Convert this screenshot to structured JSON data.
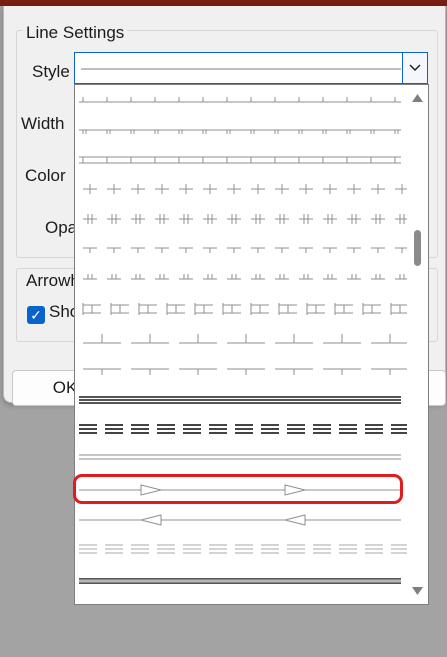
{
  "dialog": {
    "group_line_settings": "Line Settings",
    "label_style": "Style",
    "label_width": "Width",
    "label_color": "Color",
    "label_opacity_partial": "Opa",
    "group_arrowheads_partial": "Arrowh",
    "checkbox_show_partial": "Sho",
    "checkbox_checked": true,
    "ok_label": "OK"
  },
  "dropdown": {
    "scroll_position": 0.28,
    "highlighted_option_index": 14,
    "options": [
      {
        "style": "ticks-single-up"
      },
      {
        "style": "ticks-double-down"
      },
      {
        "style": "ticks-bars-down"
      },
      {
        "style": "crosses"
      },
      {
        "style": "double-crosses"
      },
      {
        "style": "ticks-down-single"
      },
      {
        "style": "ticks-double-up"
      },
      {
        "style": "dash-ibeams"
      },
      {
        "style": "dash-up-bars"
      },
      {
        "style": "dash-down-ticks"
      },
      {
        "style": "triple-thick"
      },
      {
        "style": "triple-dashed"
      },
      {
        "style": "double-thin"
      },
      {
        "style": "arrows-right"
      },
      {
        "style": "arrows-left"
      },
      {
        "style": "triple-dashed-light"
      },
      {
        "style": "thick-gray"
      }
    ]
  },
  "colors": {
    "accent": "#0a63c9",
    "highlight_border": "#e21b1b",
    "title_strip": "#7a1d12"
  }
}
